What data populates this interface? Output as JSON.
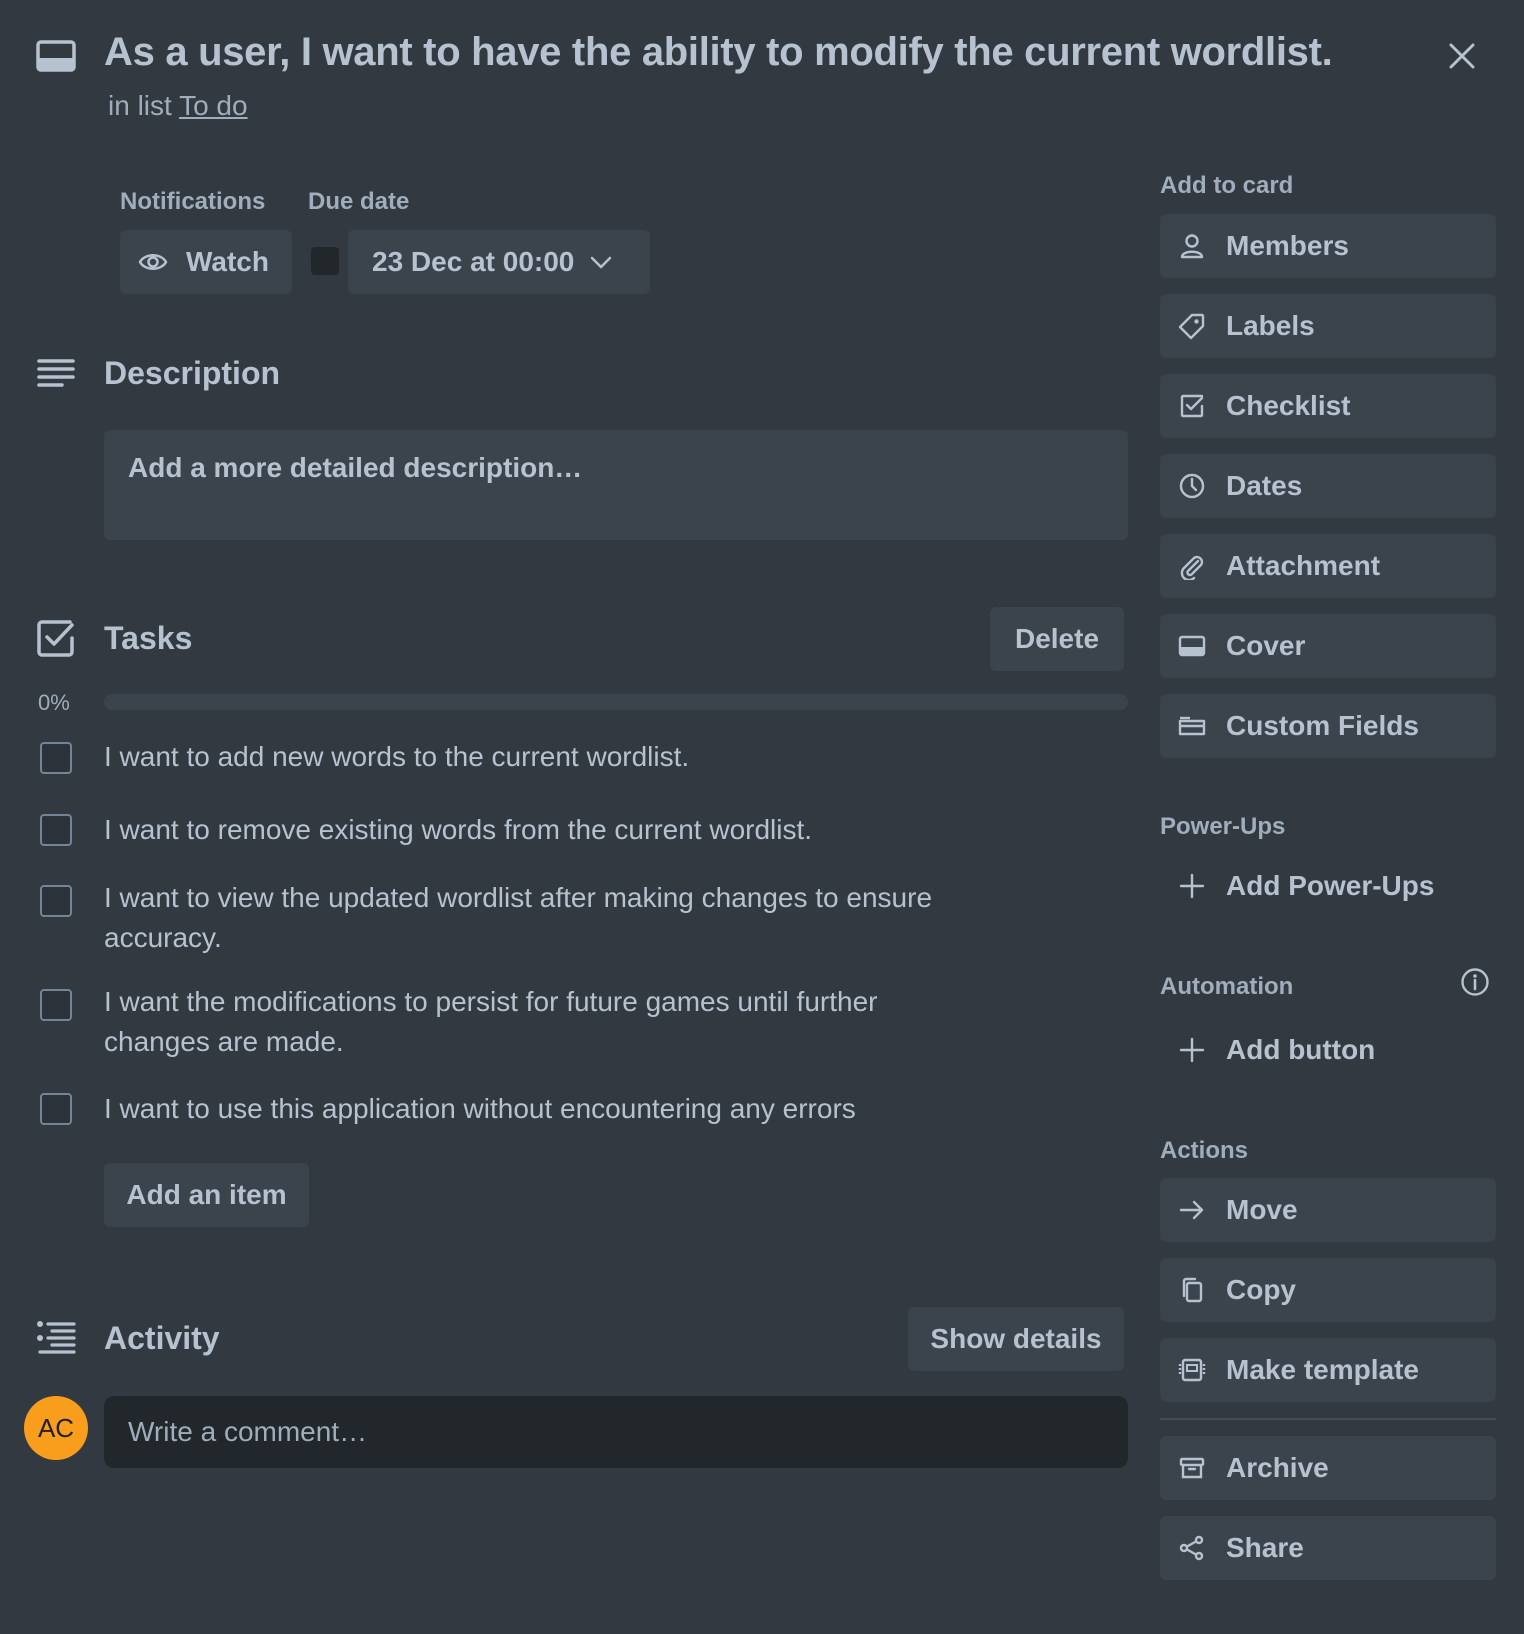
{
  "card": {
    "title": "As a user, I want to have the ability to modify the current wordlist.",
    "in_list_prefix": "in list",
    "list_name": "To do"
  },
  "notifications": {
    "label": "Notifications",
    "watch_label": "Watch"
  },
  "due": {
    "label": "Due date",
    "value": "23 Dec at 00:00",
    "complete": false
  },
  "description": {
    "title": "Description",
    "placeholder": "Add a more detailed description…"
  },
  "checklist": {
    "title": "Tasks",
    "delete_label": "Delete",
    "progress_label": "0%",
    "progress": 0,
    "items": [
      {
        "text": "I want to add new words to the current wordlist.",
        "checked": false
      },
      {
        "text": "I want to remove existing words from the current wordlist.",
        "checked": false
      },
      {
        "text": "I want to view the updated wordlist after making changes to ensure accuracy.",
        "checked": false
      },
      {
        "text": "I want the modifications to persist for future games until further changes are made.",
        "checked": false
      },
      {
        "text": "I want to use this application without encountering any errors",
        "checked": false
      }
    ],
    "add_item_label": "Add an item"
  },
  "activity": {
    "title": "Activity",
    "show_details_label": "Show details",
    "avatar_initials": "AC",
    "comment_placeholder": "Write a comment…"
  },
  "sidebar": {
    "add_to_card_label": "Add to card",
    "add_to_card": [
      {
        "label": "Members",
        "icon": "member-icon"
      },
      {
        "label": "Labels",
        "icon": "label-icon"
      },
      {
        "label": "Checklist",
        "icon": "checklist-icon"
      },
      {
        "label": "Dates",
        "icon": "clock-icon"
      },
      {
        "label": "Attachment",
        "icon": "paperclip-icon"
      },
      {
        "label": "Cover",
        "icon": "cover-icon"
      },
      {
        "label": "Custom Fields",
        "icon": "custom-fields-icon"
      }
    ],
    "power_ups_label": "Power-Ups",
    "add_power_ups_label": "Add Power-Ups",
    "automation_label": "Automation",
    "add_button_label": "Add button",
    "actions_label": "Actions",
    "actions": [
      {
        "label": "Move",
        "icon": "arrow-right-icon"
      },
      {
        "label": "Copy",
        "icon": "copy-icon"
      },
      {
        "label": "Make template",
        "icon": "template-icon"
      },
      {
        "label": "Archive",
        "icon": "archive-icon"
      },
      {
        "label": "Share",
        "icon": "share-icon"
      }
    ]
  },
  "colors": {
    "background": "#323940",
    "button": "#3b444c",
    "text": "#b6c2cf",
    "subtle_text": "#9fadbc",
    "avatar": "#f99d1c"
  }
}
